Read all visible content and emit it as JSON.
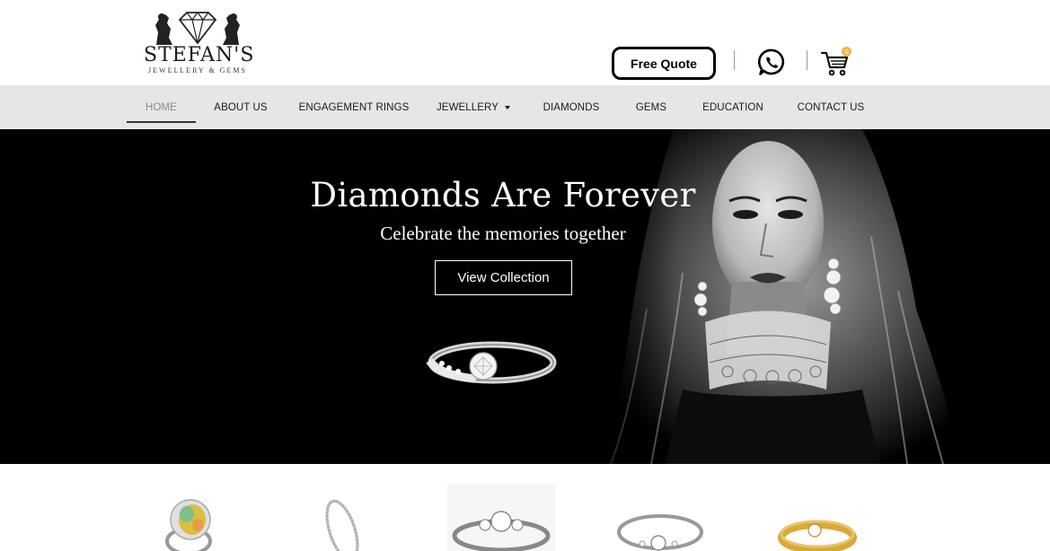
{
  "brand": {
    "name": "STEFAN'S",
    "tagline": "JEWELLERY & GEMS"
  },
  "header": {
    "quote_label": "Free Quote",
    "cart_count": "0",
    "icons": [
      "whatsapp-icon",
      "cart-icon"
    ]
  },
  "nav": {
    "items": [
      {
        "label": "HOME",
        "active": true
      },
      {
        "label": "ABOUT US"
      },
      {
        "label": "ENGAGEMENT RINGS"
      },
      {
        "label": "JEWELLERY",
        "dropdown": true
      },
      {
        "label": "DIAMONDS"
      },
      {
        "label": "GEMS"
      },
      {
        "label": "EDUCATION"
      },
      {
        "label": "CONTACT US"
      }
    ]
  },
  "hero": {
    "title": "Diamonds Are Forever",
    "subtitle": "Celebrate the memories together",
    "button_label": "View Collection"
  },
  "colors": {
    "nav_bg": "#e6e6e6",
    "hero_bg": "#000000",
    "badge": "#e8b84a",
    "gold": "#d9a93a"
  }
}
